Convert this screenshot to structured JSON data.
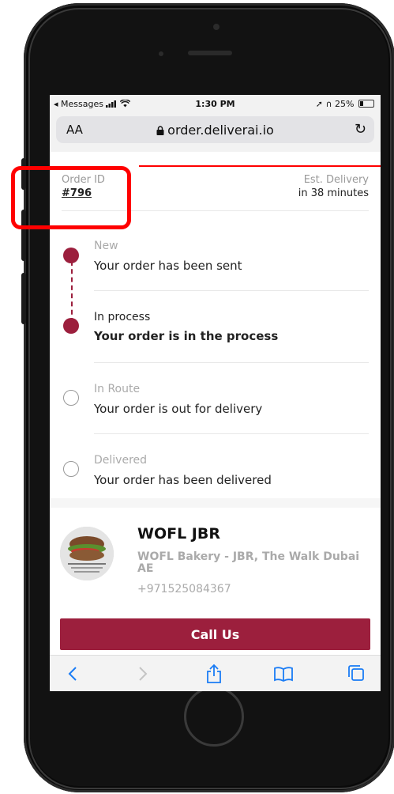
{
  "status_bar": {
    "back_app": "◂ Messages",
    "time": "1:30 PM",
    "battery": "25%"
  },
  "browser": {
    "text_size": "AA",
    "url": "order.deliverai.io"
  },
  "order": {
    "id_label": "Order ID",
    "id_value": "#796",
    "delivery_label": "Est. Delivery",
    "delivery_value": "in 38 minutes"
  },
  "steps": [
    {
      "title": "New",
      "description": "Your order has been sent",
      "state": "done"
    },
    {
      "title": "In process",
      "description": "Your order is in the process",
      "state": "current"
    },
    {
      "title": "In Route",
      "description": "Your order is out for delivery",
      "state": "pending"
    },
    {
      "title": "Delivered",
      "description": "Your order has been delivered",
      "state": "pending"
    }
  ],
  "restaurant": {
    "name": "WOFL JBR",
    "address": "WOFL Bakery - JBR, The Walk Dubai AE",
    "phone": "+971525084367",
    "call_label": "Call Us"
  },
  "colors": {
    "accent": "#9c1f3d",
    "highlight": "#ff0000"
  },
  "battery_level": 0.25
}
